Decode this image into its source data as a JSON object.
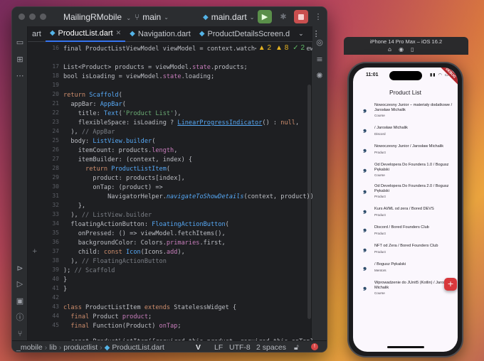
{
  "ide": {
    "project": "MailingRMobile",
    "branch": "main",
    "run_config": "main.dart",
    "tabs": [
      "art",
      "ProductList.dart",
      "Navigation.dart",
      "ProductDetailsScreen.d"
    ],
    "inspections": {
      "warnings": "2",
      "weak_warnings": "8",
      "ok": "2"
    },
    "line_numbers": [
      "16",
      "17",
      "18",
      "19",
      "20",
      "21",
      "22",
      "23",
      "24",
      "25",
      "26",
      "27",
      "28",
      "29",
      "30",
      "31",
      "32",
      "33",
      "34",
      "35",
      "36",
      "37",
      "38",
      "39",
      "40",
      "41",
      "42",
      "43",
      "44",
      "45"
    ],
    "status": {
      "crumbs": [
        "_mobile",
        "lib",
        "productlist",
        "ProductList.dart"
      ],
      "line_sep": "LF",
      "encoding": "UTF-8",
      "indent": "2 spaces"
    }
  },
  "simulator": {
    "title": "iPhone 14 Pro Max – iOS 16.2",
    "time": "11:01",
    "debug_banner": "DEBUG",
    "app_title": "Product List",
    "items": [
      {
        "title": "Nowoczesny Junior – materiały dodatkowe / Jarosław Michalik",
        "subtitle": "Course"
      },
      {
        "title": " / Jarosław Michalik",
        "subtitle": "Discord"
      },
      {
        "title": "Nowoczesny Junior / Jarosław Michalik",
        "subtitle": "Product"
      },
      {
        "title": "Od Developera Do Foundera 1.0 / Bogusz Pękalski",
        "subtitle": "Course"
      },
      {
        "title": "Od Developera Do Foundera 2.0 / Bogusz Pękalski",
        "subtitle": "Product"
      },
      {
        "title": "Kurs AI/ML od zera / Bored DEVS",
        "subtitle": "Product"
      },
      {
        "title": "Discord / Bored Founders Club",
        "subtitle": "Product"
      },
      {
        "title": "NFT od Zera / Bored Founders Club",
        "subtitle": "Product"
      },
      {
        "title": " / Bogusz Pękalski",
        "subtitle": "Mentors"
      },
      {
        "title": "Wprowadzenie do JUnit5 (Kotlin) / Jarosław Michalik",
        "subtitle": "Course"
      }
    ],
    "fab_label": "+"
  }
}
